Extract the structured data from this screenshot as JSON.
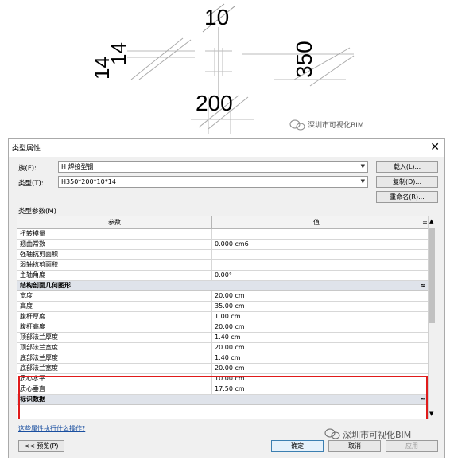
{
  "diagram": {
    "labels": {
      "web_thickness": "10",
      "flange_thickness_a": "14",
      "flange_thickness_b": "14",
      "height": "350",
      "width": "200"
    },
    "watermark_top": "深圳市可视化BIM"
  },
  "dialog": {
    "title": "类型属性",
    "close_glyph": "✕",
    "family_label": "族(F):",
    "family_value": "H 焊接型钢",
    "type_label": "类型(T):",
    "type_value": "H350*200*10*14",
    "load_button": "载入(L)...",
    "duplicate_button": "复制(D)...",
    "rename_button": "重命名(R)...",
    "type_params_label": "类型参数(M)",
    "table": {
      "col_param": "参数",
      "col_value": "值",
      "col_eq": "=",
      "rows_top": [
        {
          "param": "扭转模量",
          "value": ""
        },
        {
          "param": "翘曲常数",
          "value": "0.000 cm6"
        },
        {
          "param": "强轴抗剪面积",
          "value": ""
        },
        {
          "param": "弱轴抗剪面积",
          "value": ""
        },
        {
          "param": "主轴角度",
          "value": "0.00°"
        }
      ],
      "group_geometry": "结构剖面几何图形",
      "group_toggle": "≈",
      "rows_geometry": [
        {
          "param": "宽度",
          "value": "20.00 cm"
        },
        {
          "param": "高度",
          "value": "35.00 cm"
        },
        {
          "param": "腹杆厚度",
          "value": "1.00 cm"
        },
        {
          "param": "腹杆高度",
          "value": "20.00 cm"
        },
        {
          "param": "顶部法兰厚度",
          "value": "1.40 cm"
        },
        {
          "param": "顶部法兰宽度",
          "value": "20.00 cm"
        },
        {
          "param": "底部法兰厚度",
          "value": "1.40 cm"
        },
        {
          "param": "底部法兰宽度",
          "value": "20.00 cm"
        },
        {
          "param": "质心水平",
          "value": "10.00 cm"
        },
        {
          "param": "质心垂直",
          "value": "17.50 cm"
        }
      ],
      "group_identity": "标识数据"
    },
    "help_link": "这些属性执行什么操作?",
    "preview_button": "<< 预览(P)",
    "ok_button": "确定",
    "cancel_button": "取消",
    "apply_button": "应用",
    "watermark_bottom": "深圳市可视化BIM"
  },
  "colors": {
    "highlight": "#e01b1b",
    "group_band": "#dfe3ea",
    "link": "#1a4fa0"
  }
}
